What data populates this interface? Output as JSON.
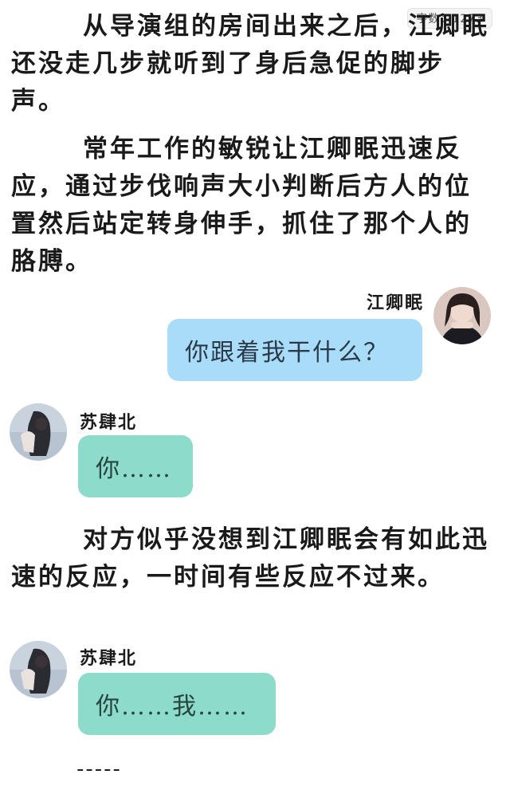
{
  "word_count": "字数：1273",
  "paragraphs": {
    "p1": "从导演组的房间出来之后，江卿眠还没走几步就听到了身后急促的脚步声。",
    "p2": "常年工作的敏锐让江卿眠迅速反应，通过步伐响声大小判断后方人的位置然后站定转身伸手，抓住了那个人的胳膊。",
    "p3": "对方似乎没想到江卿眠会有如此迅速的反应，一时间有些反应不过来。"
  },
  "chat": {
    "msg1": {
      "speaker": "江卿眠",
      "text": "你跟着我干什么？",
      "avatar": "girl-portrait-avatar"
    },
    "msg2": {
      "speaker": "苏肆北",
      "text": "你……",
      "avatar": "blurred-portrait-avatar"
    },
    "msg3": {
      "speaker": "苏肆北",
      "text": "你……我……",
      "avatar": "blurred-portrait-avatar"
    }
  },
  "divider": "-----",
  "colors": {
    "right_bubble": "#a9dcf9",
    "left_bubble": "#8ddbcb",
    "text": "#1a1a1a"
  }
}
